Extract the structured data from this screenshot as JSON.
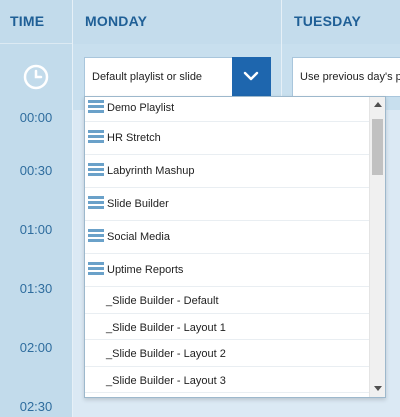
{
  "header": {
    "time_label": "TIME",
    "days": [
      "MONDAY",
      "TUESDAY"
    ]
  },
  "time_slots": [
    "00:00",
    "00:30",
    "01:00",
    "01:30",
    "02:00",
    "02:30"
  ],
  "monday": {
    "select_value": "Default playlist or slide",
    "dropdown_expanded": true
  },
  "tuesday": {
    "select_value": "Use previous day's p"
  },
  "dropdown": {
    "items": [
      {
        "label": "Demo Playlist",
        "icon": "hamburger-icon"
      },
      {
        "label": "HR Stretch",
        "icon": "hamburger-icon"
      },
      {
        "label": "Labyrinth Mashup",
        "icon": "hamburger-icon"
      },
      {
        "label": "Slide Builder",
        "icon": "hamburger-icon"
      },
      {
        "label": "Social Media",
        "icon": "hamburger-icon"
      },
      {
        "label": "Uptime Reports",
        "icon": "hamburger-icon"
      },
      {
        "label": "_Slide Builder - Default"
      },
      {
        "label": "_Slide Builder - Layout 1"
      },
      {
        "label": "_Slide Builder - Layout 2"
      },
      {
        "label": "_Slide Builder - Layout 3"
      }
    ]
  },
  "colors": {
    "accent": "#1e66ae",
    "header_text": "#1f5f96",
    "background": "#c4dcec"
  }
}
